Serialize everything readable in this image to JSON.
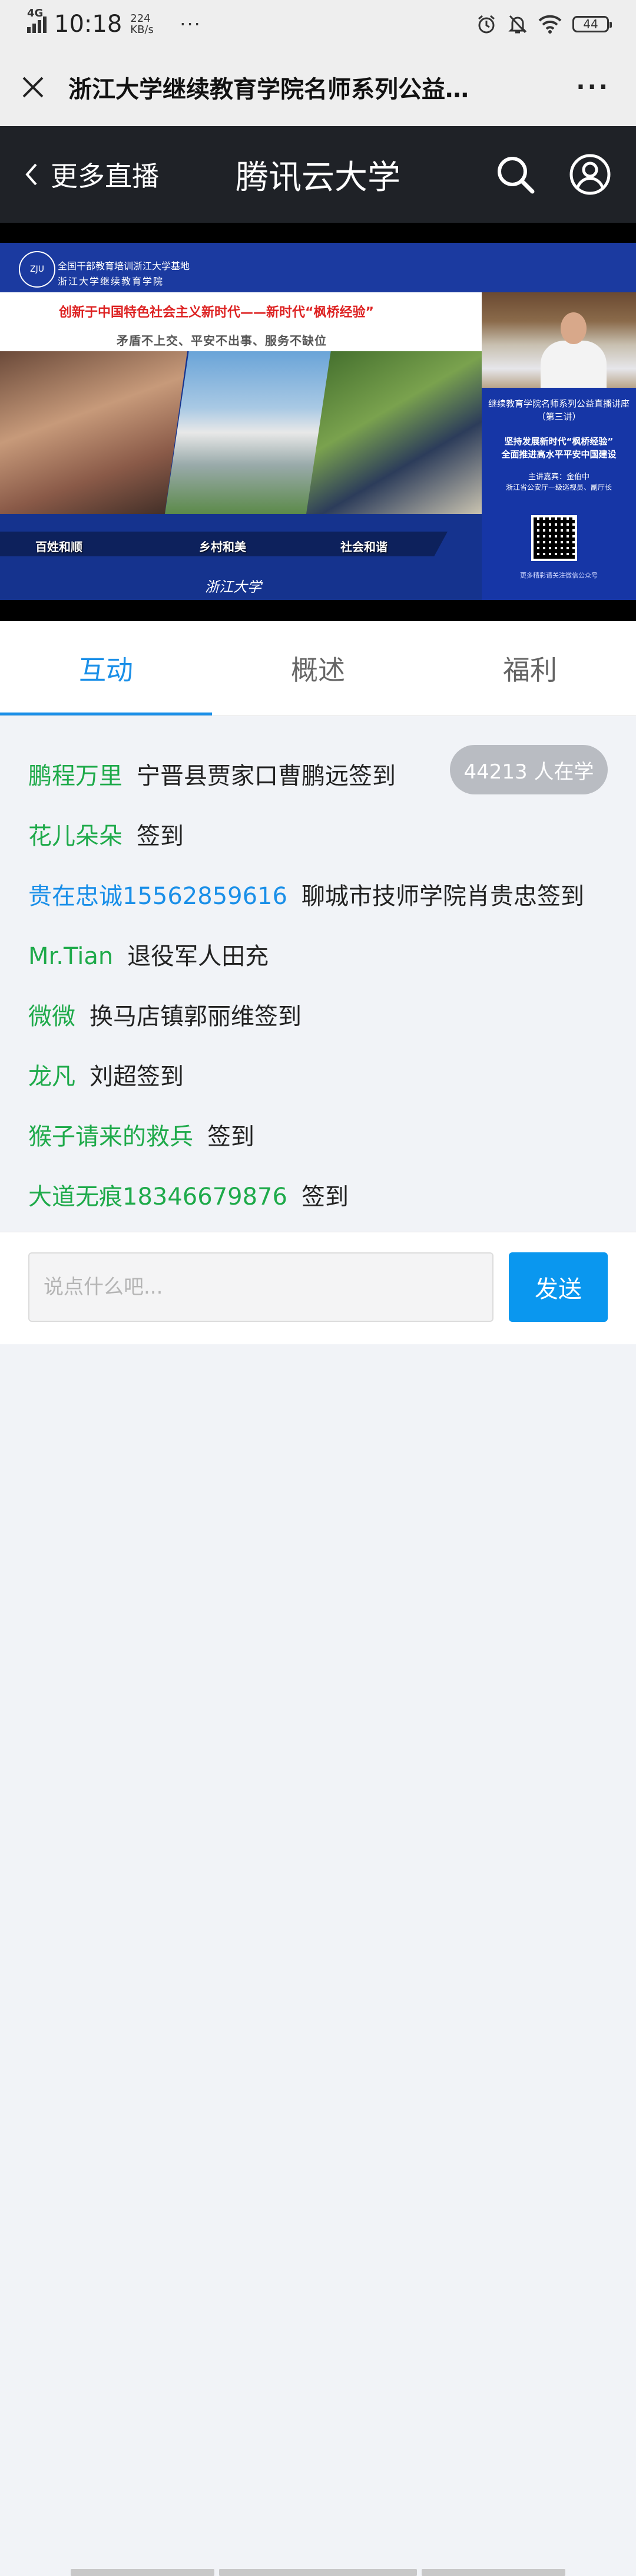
{
  "status_bar": {
    "network": "4G",
    "time": "10:18",
    "speed_value": "224",
    "speed_unit": "KB/s",
    "more": "···",
    "battery": "44",
    "icons": [
      "alarm-icon",
      "mute-bell-icon",
      "wifi-icon",
      "battery-icon"
    ]
  },
  "titlebar": {
    "close_icon": "close-icon",
    "title": "浙江大学继续教育学院名师系列公益…",
    "more": "···"
  },
  "header": {
    "back_label": "更多直播",
    "title": "腾讯云大学",
    "icons": [
      "search-icon",
      "user-icon"
    ]
  },
  "video": {
    "org_line1": "全国干部教育培训浙江大学基地",
    "org_line2": "浙江大学继续教育学院",
    "headline": "创新于中国特色社会主义新时代——新时代“枫桥经验”",
    "subheadline": "矛盾不上交、平安不出事、服务不缺位",
    "captions": [
      "百姓和顺",
      "乡村和美",
      "社会和谐"
    ],
    "signature": "浙江大学",
    "panel_line1": "继续教育学院名师系列公益直播讲座",
    "panel_line2": "（第三讲）",
    "panel_line3": "坚持发展新时代“枫桥经验”",
    "panel_line4": "全面推进高水平平安中国建设",
    "panel_speaker": "主讲嘉宾：金伯中",
    "panel_speaker_title": "浙江省公安厅一级巡视员、副厅长",
    "panel_qr_note": "更多精彩请关注微信公众号"
  },
  "tabs": [
    {
      "label": "互动",
      "active": true
    },
    {
      "label": "概述",
      "active": false
    },
    {
      "label": "福利",
      "active": false
    }
  ],
  "chat": {
    "learning_count": "44213 人在学",
    "messages": [
      {
        "nick": "鹏程万里",
        "text": "宁晋县贾家口曹鹏远签到",
        "color": "green"
      },
      {
        "nick": "花儿朵朵",
        "text": "签到",
        "color": "green"
      },
      {
        "nick": "贵在忠诚15562859616",
        "text": "聊城市技师学院肖贵忠签到",
        "color": "blue"
      },
      {
        "nick": "Mr.Tian",
        "text": "退役军人田充",
        "color": "green"
      },
      {
        "nick": "微微",
        "text": "换马店镇郭丽维签到",
        "color": "green"
      },
      {
        "nick": "龙凡",
        "text": "刘超签到",
        "color": "green"
      },
      {
        "nick": "猴子请来的救兵",
        "text": "签到",
        "color": "green"
      },
      {
        "nick": "大道无痕18346679876",
        "text": "签到",
        "color": "green"
      }
    ]
  },
  "input": {
    "placeholder": "说点什么吧...",
    "send_label": "发送"
  },
  "colors": {
    "accent": "#1a8fe8",
    "nick_green": "#1eaa4a",
    "header_bg": "#1f2227",
    "send_bg": "#0a97ef"
  }
}
